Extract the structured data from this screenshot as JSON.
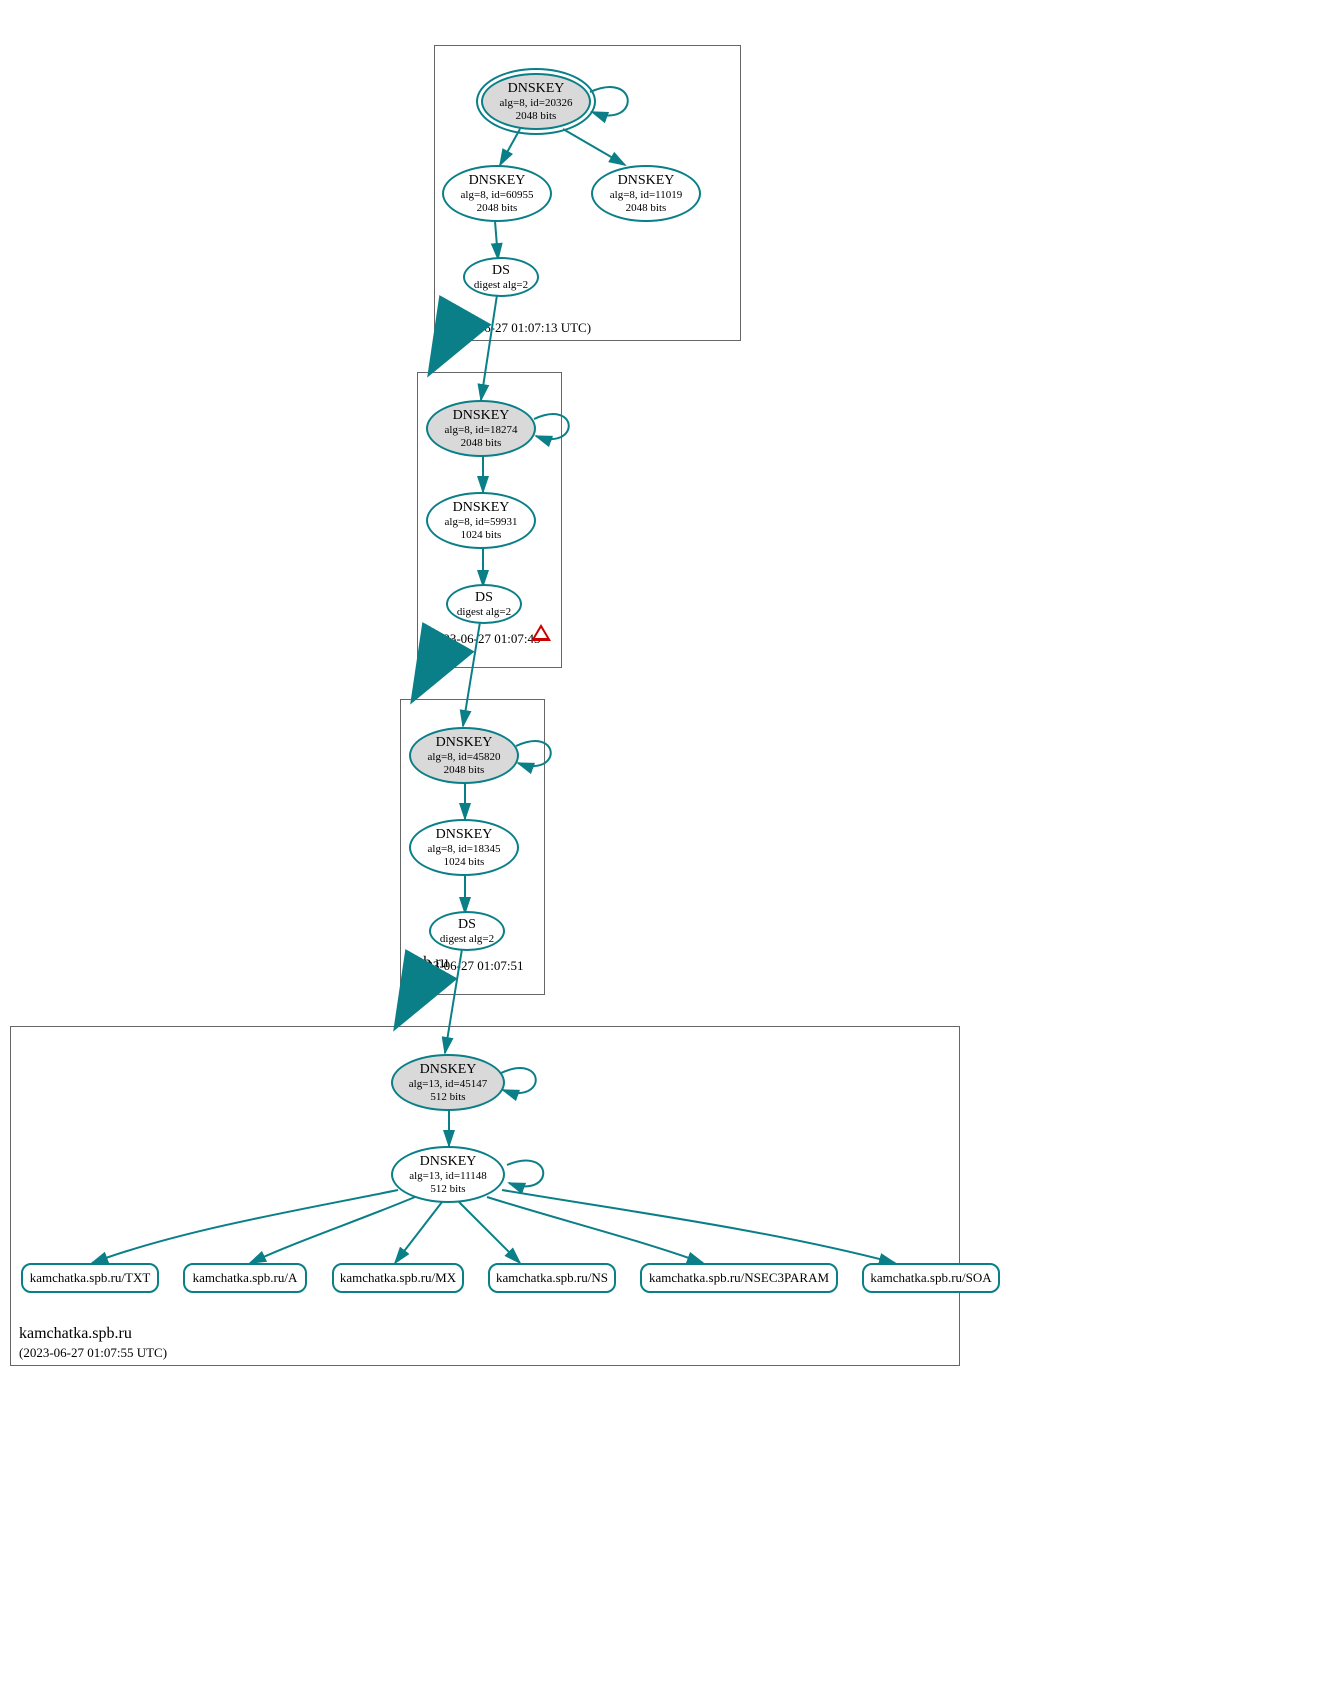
{
  "zones": {
    "root": {
      "label": ".",
      "timestamp": "(2023-06-27 01:07:13 UTC)"
    },
    "ru": {
      "label": "ru",
      "timestamp": "(2023-06-27 01:07:43 UTC)"
    },
    "spb": {
      "label": "spb.ru",
      "timestamp": "(2023-06-27 01:07:51 UTC)"
    },
    "kam": {
      "label": "kamchatka.spb.ru",
      "timestamp": "(2023-06-27 01:07:55 UTC)"
    }
  },
  "nodes": {
    "root_ksk": {
      "title": "DNSKEY",
      "line1": "alg=8, id=20326",
      "line2": "2048 bits"
    },
    "root_zsk": {
      "title": "DNSKEY",
      "line1": "alg=8, id=60955",
      "line2": "2048 bits"
    },
    "root_zsk2": {
      "title": "DNSKEY",
      "line1": "alg=8, id=11019",
      "line2": "2048 bits"
    },
    "root_ds": {
      "title": "DS",
      "line1": "digest alg=2"
    },
    "ru_ksk": {
      "title": "DNSKEY",
      "line1": "alg=8, id=18274",
      "line2": "2048 bits"
    },
    "ru_zsk": {
      "title": "DNSKEY",
      "line1": "alg=8, id=59931",
      "line2": "1024 bits"
    },
    "ru_ds": {
      "title": "DS",
      "line1": "digest alg=2"
    },
    "spb_ksk": {
      "title": "DNSKEY",
      "line1": "alg=8, id=45820",
      "line2": "2048 bits"
    },
    "spb_zsk": {
      "title": "DNSKEY",
      "line1": "alg=8, id=18345",
      "line2": "1024 bits"
    },
    "spb_ds": {
      "title": "DS",
      "line1": "digest alg=2"
    },
    "kam_ksk": {
      "title": "DNSKEY",
      "line1": "alg=13, id=45147",
      "line2": "512 bits"
    },
    "kam_zsk": {
      "title": "DNSKEY",
      "line1": "alg=13, id=11148",
      "line2": "512 bits"
    }
  },
  "records": {
    "txt": "kamchatka.spb.ru/TXT",
    "a": "kamchatka.spb.ru/A",
    "mx": "kamchatka.spb.ru/MX",
    "ns": "kamchatka.spb.ru/NS",
    "nsec3": "kamchatka.spb.ru/NSEC3PARAM",
    "soa": "kamchatka.spb.ru/SOA"
  }
}
